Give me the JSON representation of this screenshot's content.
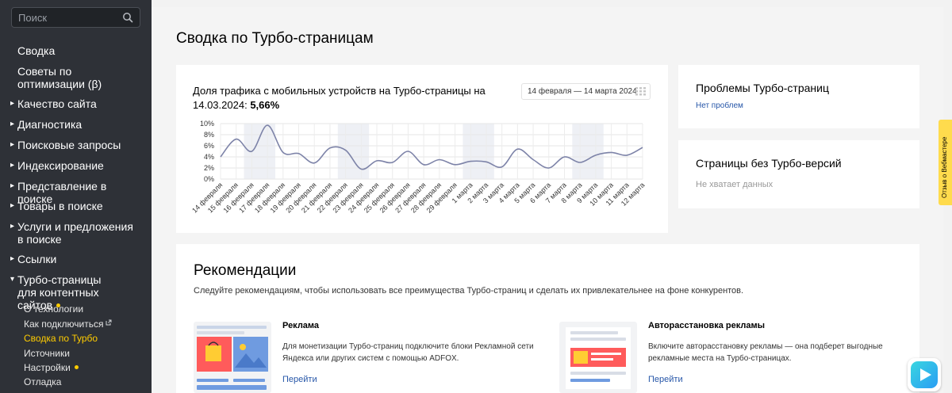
{
  "sidebar": {
    "search_placeholder": "Поиск",
    "items": [
      {
        "label": "Сводка",
        "arrow": false
      },
      {
        "label": "Советы по оптимизации (β)",
        "arrow": false
      },
      {
        "label": "Качество сайта",
        "arrow": true
      },
      {
        "label": "Диагностика",
        "arrow": true
      },
      {
        "label": "Поисковые запросы",
        "arrow": true
      },
      {
        "label": "Индексирование",
        "arrow": true
      },
      {
        "label": "Представление в поиске",
        "arrow": true
      },
      {
        "label": "Товары в поиске",
        "arrow": true
      },
      {
        "label": "Услуги и предложения в поиске",
        "arrow": true
      },
      {
        "label": "Ссылки",
        "arrow": true
      },
      {
        "label": "Турбо-страницы для контентных сайтов",
        "arrow": true,
        "expanded": true
      }
    ],
    "sub_items": [
      {
        "label": "О технологии"
      },
      {
        "label": "Как подключиться"
      },
      {
        "label": "Сводка по Турбо"
      },
      {
        "label": "Источники"
      },
      {
        "label": "Настройки"
      },
      {
        "label": "Отладка"
      }
    ]
  },
  "page": {
    "title": "Сводка по Турбо-страницам"
  },
  "traffic": {
    "title": "Доля трафика с мобильных устройств на Турбо-страницы на 14.03.2024:",
    "value": "5,66%",
    "date_range": "14 февраля — 14 марта 2024"
  },
  "chart_data": {
    "type": "line",
    "title": "",
    "xlabel": "",
    "ylabel": "",
    "ylim": [
      0,
      10
    ],
    "yticks": [
      "0%",
      "2%",
      "4%",
      "6%",
      "8%",
      "10%"
    ],
    "grid": true,
    "categories": [
      "14 февраля",
      "15 февраля",
      "16 февраля",
      "17 февраля",
      "18 февраля",
      "19 февраля",
      "20 февраля",
      "21 февраля",
      "22 февраля",
      "23 февраля",
      "24 февраля",
      "25 февраля",
      "26 февраля",
      "27 февраля",
      "28 февраля",
      "29 февраля",
      "1 марта",
      "2 марта",
      "3 марта",
      "4 марта",
      "5 марта",
      "6 марта",
      "7 марта",
      "8 марта",
      "9 марта",
      "10 марта",
      "11 марта",
      "12 марта"
    ],
    "series": [
      {
        "values": [
          4.0,
          7.2,
          5.0,
          9.7,
          4.8,
          4.6,
          2.9,
          5.6,
          5.2,
          1.8,
          3.3,
          3.0,
          5.0,
          2.6,
          3.5,
          2.6,
          3.2,
          3.1,
          2.2,
          5.4,
          3.5,
          2.0,
          4.0,
          3.0,
          4.3,
          4.8,
          4.3,
          5.7
        ],
        "color": "#7d83a8"
      }
    ],
    "weekend_bands": [
      [
        2,
        3
      ],
      [
        8,
        9
      ],
      [
        16,
        17
      ],
      [
        23,
        24
      ]
    ]
  },
  "problems": {
    "title": "Проблемы Турбо-страниц",
    "link": "Нет проблем"
  },
  "no_turbo": {
    "title": "Страницы без Турбо-версий",
    "status": "Не хватает данных"
  },
  "recommendations": {
    "title": "Рекомендации",
    "description": "Следуйте рекомендациям, чтобы использовать все преимущества Турбо-страниц и сделать их привлекательнее на фоне конкурентов.",
    "items": [
      {
        "title": "Реклама",
        "text": "Для монетизации Турбо-страниц подключите блоки Рекламной сети Яндекса или других систем с помощью ADFOX.",
        "link": "Перейти"
      },
      {
        "title": "Авторасстановка рекламы",
        "text": "Включите авторасстановку рекламы — она подберет выгодные рекламные места на Турбо-страницах.",
        "link": "Перейти"
      }
    ]
  },
  "feedback": {
    "label": "Отзыв о Вебмастере"
  },
  "colors": {
    "sidebar_bg": "#2e3137",
    "accent": "#ffcc00",
    "link": "#2656a8",
    "line": "#7d83a8"
  }
}
